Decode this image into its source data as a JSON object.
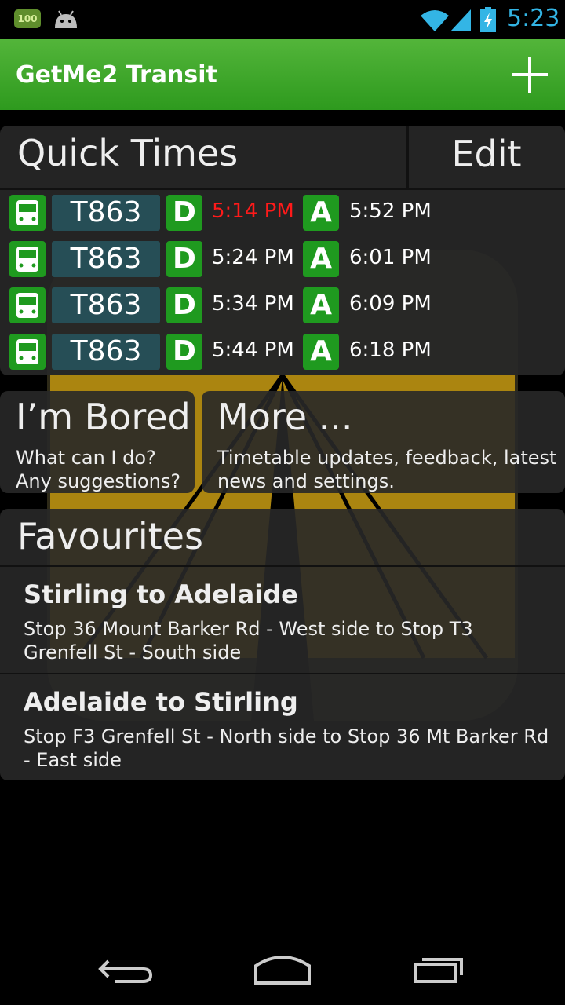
{
  "status_bar": {
    "battery_badge": "100",
    "time": "5:23",
    "icons": [
      "battery-badge-icon",
      "android-icon",
      "wifi-icon",
      "signal-icon",
      "battery-charging-icon"
    ]
  },
  "action_bar": {
    "title": "GetMe2 Transit",
    "add_icon": "plus-icon",
    "color": "#3fa82b"
  },
  "quick_times": {
    "title": "Quick Times",
    "edit_label": "Edit",
    "depart_badge": "D",
    "arrive_badge": "A",
    "rows": [
      {
        "route": "T863",
        "depart": "5:14 PM",
        "arrive": "5:52 PM",
        "late": true
      },
      {
        "route": "T863",
        "depart": "5:24 PM",
        "arrive": "6:01 PM",
        "late": false
      },
      {
        "route": "T863",
        "depart": "5:34 PM",
        "arrive": "6:09 PM",
        "late": false
      },
      {
        "route": "T863",
        "depart": "5:44 PM",
        "arrive": "6:18 PM",
        "late": false
      }
    ],
    "late_color": "#ff1a1a"
  },
  "bored": {
    "title": "I’m Bored",
    "line1": "What can I do?",
    "line2": "Any suggestions?"
  },
  "more": {
    "title": "More ...",
    "line1": "Timetable updates, feedback, latest",
    "line2": "news and settings."
  },
  "favourites": {
    "title": "Favourites",
    "items": [
      {
        "name": "Stirling to Adelaide",
        "desc": "Stop 36 Mount Barker Rd - West side to Stop T3 Grenfell St - South side"
      },
      {
        "name": "Adelaide to Stirling",
        "desc": "Stop F3 Grenfell St - North side to Stop 36 Mt Barker Rd - East side"
      }
    ]
  },
  "nav_bar": {
    "icons": [
      "back-icon",
      "home-icon",
      "recents-icon"
    ]
  }
}
